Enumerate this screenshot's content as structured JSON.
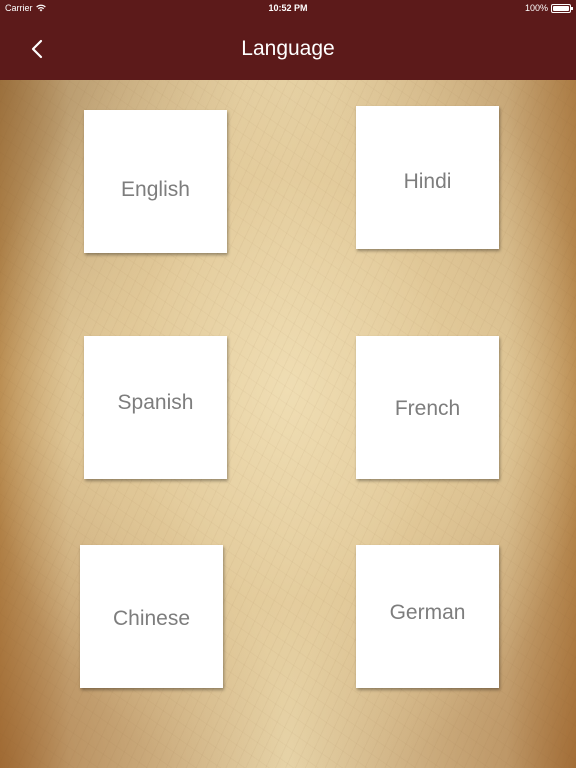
{
  "status_bar": {
    "carrier": "Carrier",
    "time": "10:52 PM",
    "battery": "100%"
  },
  "nav": {
    "title": "Language",
    "back_icon": "chevron-left-icon"
  },
  "languages": [
    {
      "label": "English"
    },
    {
      "label": "Hindi"
    },
    {
      "label": "Spanish"
    },
    {
      "label": "French"
    },
    {
      "label": "Chinese"
    },
    {
      "label": "German"
    }
  ],
  "colors": {
    "nav_bar": "#5c1a1a",
    "card_background": "#ffffff",
    "card_text": "#7d7d7d",
    "title_text": "#ffffff"
  }
}
